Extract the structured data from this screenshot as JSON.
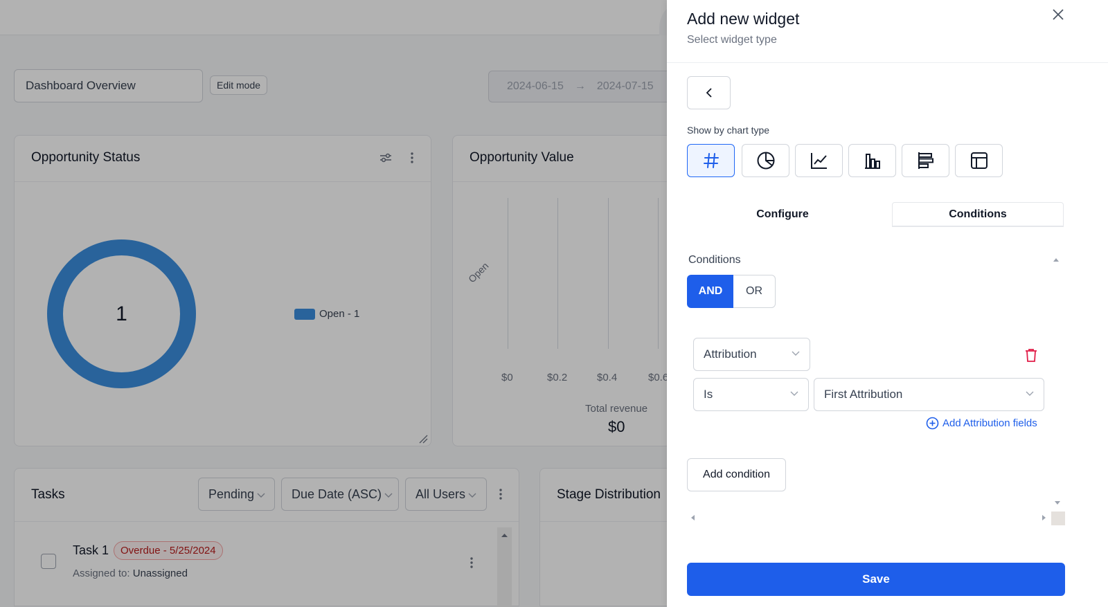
{
  "dashboard": {
    "name": "Dashboard Overview",
    "edit_mode_label": "Edit mode",
    "date_start": "2024-06-15",
    "date_arrow": "→",
    "date_end": "2024-07-15"
  },
  "opportunity_status": {
    "title": "Opportunity Status",
    "donut_value": "1",
    "legend": "Open - 1",
    "color": "#3b8fdf"
  },
  "opportunity_value": {
    "title": "Opportunity Value",
    "category": "Open",
    "ticks": [
      "$0",
      "$0.2",
      "$0.4",
      "$0.6"
    ],
    "total_label": "Total revenue",
    "total_value": "$0"
  },
  "tasks": {
    "title": "Tasks",
    "filters": [
      "Pending",
      "Due Date (ASC)",
      "All Users"
    ],
    "items": [
      {
        "name": "Task 1",
        "badge": "Overdue - 5/25/2024",
        "assigned_prefix": "Assigned to:",
        "assigned_to": "Unassigned"
      }
    ]
  },
  "stage_distribution": {
    "title": "Stage Distribution"
  },
  "drawer": {
    "title": "Add new widget",
    "subtitle": "Select widget type",
    "chart_type_label": "Show by chart type",
    "chart_types": [
      "number",
      "pie",
      "line",
      "bar",
      "horizontal-bar",
      "table"
    ],
    "selected_chart_type": "number",
    "tabs": [
      "Configure",
      "Conditions"
    ],
    "active_tab": "Conditions",
    "conditions_label": "Conditions",
    "logic": {
      "and": "AND",
      "or": "OR",
      "selected": "AND"
    },
    "condition": {
      "field": "Attribution",
      "operator": "Is",
      "value": "First Attribution"
    },
    "add_attribution_label": "Add Attribution fields",
    "add_condition_label": "Add condition",
    "save_label": "Save",
    "accent_color": "#1e5eea"
  }
}
